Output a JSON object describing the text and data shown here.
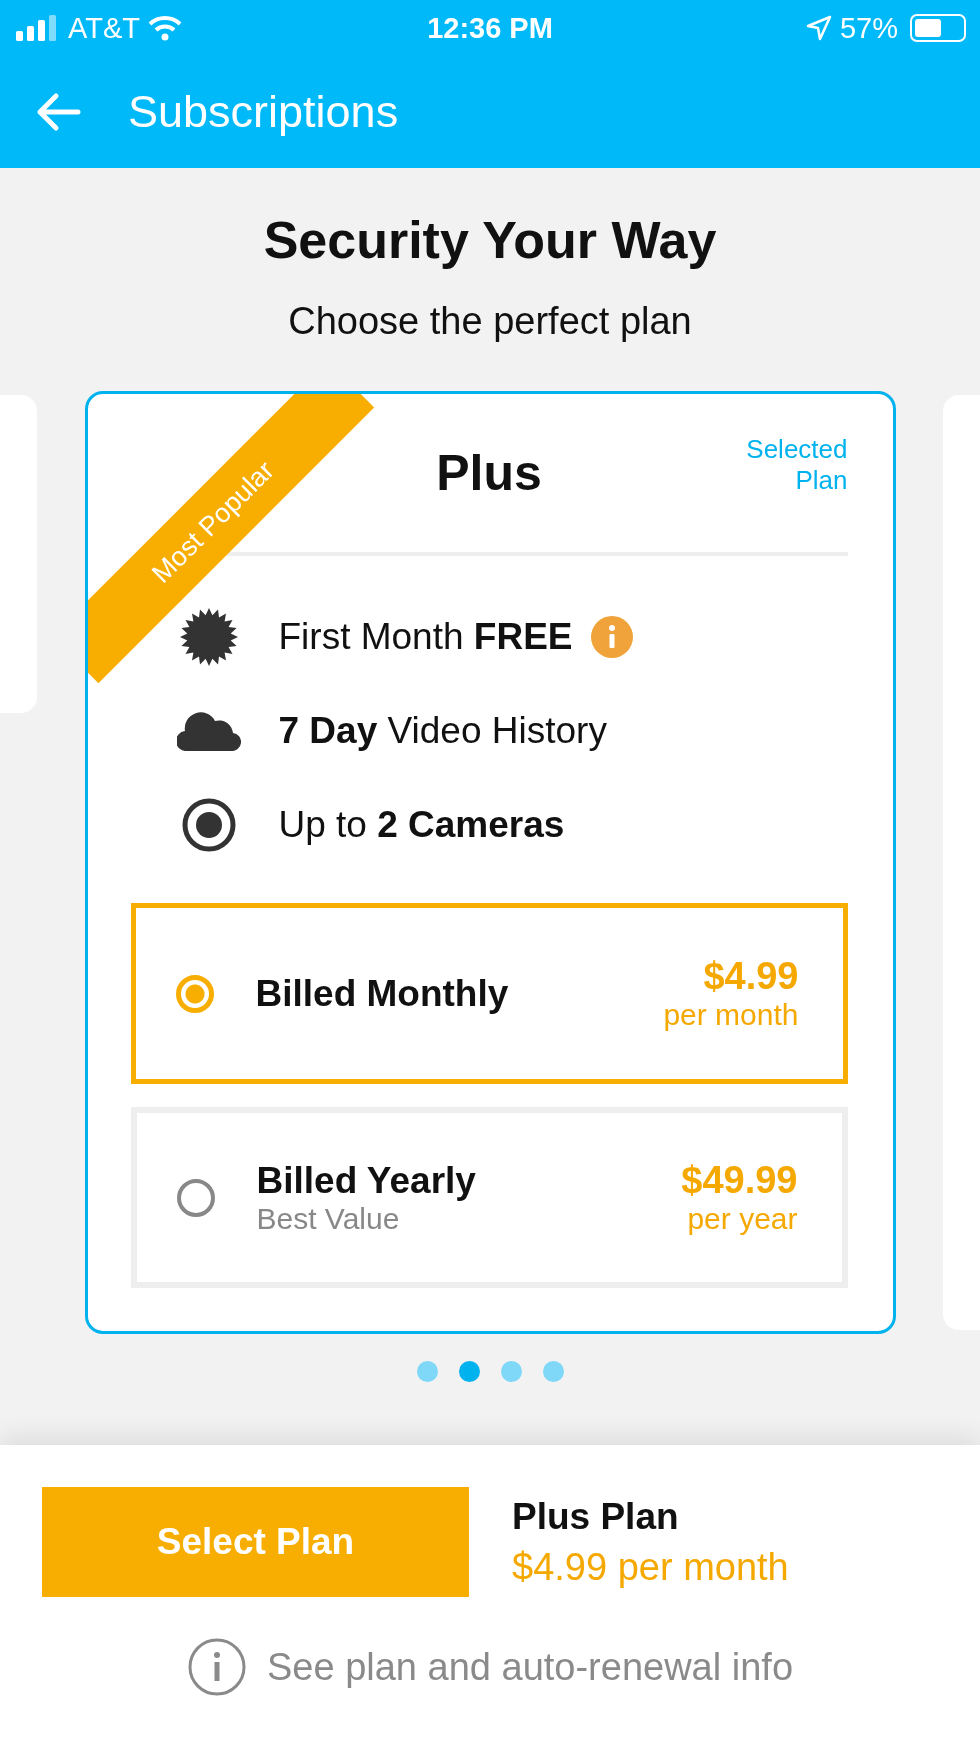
{
  "status_bar": {
    "carrier": "AT&T",
    "time": "12:36 PM",
    "battery": "57%"
  },
  "header": {
    "title": "Subscriptions"
  },
  "hero": {
    "title": "Security Your Way",
    "subtitle": "Choose the perfect plan"
  },
  "plan": {
    "ribbon": "Most Popular",
    "name": "Plus",
    "selected_label": "Selected Plan",
    "features": [
      {
        "kind": "badge",
        "text": "First Month **FREE**",
        "info": true
      },
      {
        "kind": "cloud",
        "text": "**7 Day** Video History",
        "info": false
      },
      {
        "kind": "camera",
        "text": "Up to **2 Cameras**",
        "info": false
      }
    ],
    "billing": [
      {
        "title": "Billed Monthly",
        "price": "$4.99",
        "period": "per month",
        "selected": true
      },
      {
        "title": "Billed Yearly",
        "note": "Best Value",
        "price": "$49.99",
        "period": "per year",
        "selected": false
      }
    ]
  },
  "pager": [
    {
      "selected": false
    },
    {
      "selected": true
    },
    {
      "selected": false
    },
    {
      "selected": false
    }
  ],
  "footer": {
    "button": "Select Plan",
    "summary_title": "Plus Plan",
    "summary_price": "$4.99 per month",
    "info_link": "See plan and auto-renewal info"
  }
}
